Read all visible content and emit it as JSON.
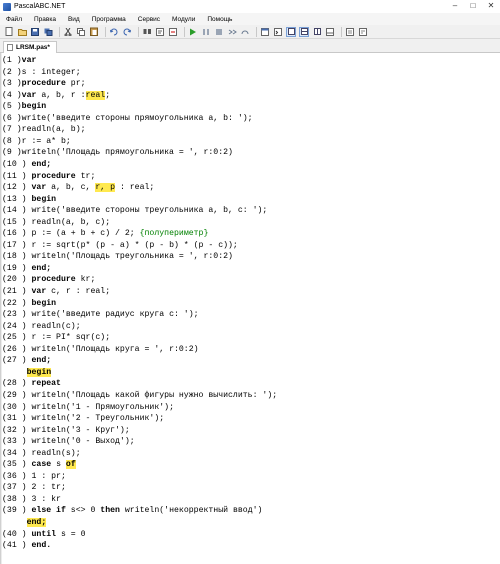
{
  "window": {
    "title": "PascalABC.NET",
    "minimize_glyph": "–",
    "maximize_glyph": "□",
    "close_glyph": "✕"
  },
  "menu": [
    "Файл",
    "Правка",
    "Вид",
    "Программа",
    "Сервис",
    "Модули",
    "Помощь"
  ],
  "toolbar": {
    "icons": [
      "new-file-icon",
      "open-icon",
      "save-icon",
      "save-all-icon",
      "cut-icon",
      "copy-icon",
      "paste-icon",
      "undo-icon",
      "redo-icon",
      "find-icon",
      "replace-icon",
      "goto-icon",
      "run-icon",
      "pause-icon",
      "stop-icon",
      "step-icon",
      "step-over-icon",
      "form-icon",
      "cmd-icon",
      "view1-icon",
      "view2-icon",
      "view3-icon",
      "output-icon",
      "help-icon",
      "about-icon"
    ]
  },
  "tab": {
    "label": "LRSM.pas*"
  },
  "code": {
    "highlight_color": "#ffe94f",
    "comment_color": "#008000",
    "lines": [
      {
        "n": "1",
        "segs": [
          {
            "t": "var",
            "k": "kw"
          }
        ]
      },
      {
        "n": "2",
        "segs": [
          {
            "t": "s : integer;"
          }
        ]
      },
      {
        "n": "3",
        "segs": [
          {
            "t": "procedure",
            "k": "kw"
          },
          {
            "t": " pr;"
          }
        ]
      },
      {
        "n": "4",
        "segs": [
          {
            "t": "var",
            "k": "kw"
          },
          {
            "t": " a, b, r :"
          },
          {
            "t": "real",
            "k": "hl"
          },
          {
            "t": ";"
          }
        ]
      },
      {
        "n": "5",
        "segs": [
          {
            "t": "begin",
            "k": "kw"
          }
        ]
      },
      {
        "n": "6",
        "segs": [
          {
            "t": "write('введите стороны прямоугольника a, b: ');"
          }
        ]
      },
      {
        "n": "7",
        "segs": [
          {
            "t": "readln(a, b);"
          }
        ]
      },
      {
        "n": "8",
        "segs": [
          {
            "t": "r := a* b;"
          }
        ]
      },
      {
        "n": "9",
        "segs": [
          {
            "t": "writeln('Площадь прямоугольника = ', r:0:2)"
          }
        ]
      },
      {
        "n": "10",
        "segs": [
          {
            "t": " end;",
            "k": "kw"
          }
        ]
      },
      {
        "n": "11",
        "segs": [
          {
            "t": " procedure",
            "k": "kw"
          },
          {
            "t": " tr;"
          }
        ]
      },
      {
        "n": "12",
        "segs": [
          {
            "t": " var",
            "k": "kw"
          },
          {
            "t": " a, b, c, "
          },
          {
            "t": "r, p",
            "k": "hl"
          },
          {
            "t": " : real;"
          }
        ]
      },
      {
        "n": "13",
        "segs": [
          {
            "t": " begin",
            "k": "kw"
          }
        ]
      },
      {
        "n": "14",
        "segs": [
          {
            "t": " write('введите стороны треугольника a, b, c: ');"
          }
        ]
      },
      {
        "n": "15",
        "segs": [
          {
            "t": " readln(a, b, c);"
          }
        ]
      },
      {
        "n": "16",
        "segs": [
          {
            "t": " p := (a + b + c) / 2; "
          },
          {
            "t": "{полупериметр}",
            "k": "cmt"
          }
        ]
      },
      {
        "n": "17",
        "segs": [
          {
            "t": " r := sqrt(p* (p - a) * (p - b) * (p - c));"
          }
        ]
      },
      {
        "n": "18",
        "segs": [
          {
            "t": " writeln('Площадь треугольника = ', r:0:2)"
          }
        ]
      },
      {
        "n": "19",
        "segs": [
          {
            "t": " end;",
            "k": "kw"
          }
        ]
      },
      {
        "n": "20",
        "segs": [
          {
            "t": " procedure",
            "k": "kw"
          },
          {
            "t": " kr;"
          }
        ]
      },
      {
        "n": "21",
        "segs": [
          {
            "t": " var",
            "k": "kw"
          },
          {
            "t": " c, r : real;"
          }
        ]
      },
      {
        "n": "22",
        "segs": [
          {
            "t": " begin",
            "k": "kw"
          }
        ]
      },
      {
        "n": "23",
        "segs": [
          {
            "t": " write('введите радиус круга c: ');"
          }
        ]
      },
      {
        "n": "24",
        "segs": [
          {
            "t": " readln(c);"
          }
        ]
      },
      {
        "n": "25",
        "segs": [
          {
            "t": " r := PI* sqr(c);"
          }
        ]
      },
      {
        "n": "26",
        "segs": [
          {
            "t": " writeln('Площадь круга = ', r:0:2)"
          }
        ]
      },
      {
        "n": "27",
        "segs": [
          {
            "t": " end;",
            "k": "kw"
          }
        ]
      },
      {
        "n": "",
        "segs": [
          {
            "t": "     "
          },
          {
            "t": "begin",
            "k": "kwhl"
          }
        ]
      },
      {
        "n": "28",
        "segs": [
          {
            "t": " repeat",
            "k": "kw"
          }
        ]
      },
      {
        "n": "29",
        "segs": [
          {
            "t": " writeln('Площадь какой фигуры нужно вычислить: ');"
          }
        ]
      },
      {
        "n": "30",
        "segs": [
          {
            "t": " writeln('1 - Прямоугольник');"
          }
        ]
      },
      {
        "n": "31",
        "segs": [
          {
            "t": " writeln('2 - Треугольник');"
          }
        ]
      },
      {
        "n": "32",
        "segs": [
          {
            "t": " writeln('3 - Круг');"
          }
        ]
      },
      {
        "n": "33",
        "segs": [
          {
            "t": " writeln('0 - Выход');"
          }
        ]
      },
      {
        "n": "34",
        "segs": [
          {
            "t": " readln(s);"
          }
        ]
      },
      {
        "n": "35",
        "segs": [
          {
            "t": " case",
            "k": "kw"
          },
          {
            "t": " s "
          },
          {
            "t": "of",
            "k": "kwhl"
          }
        ]
      },
      {
        "n": "36",
        "segs": [
          {
            "t": " 1 : pr;"
          }
        ]
      },
      {
        "n": "37",
        "segs": [
          {
            "t": " 2 : tr;"
          }
        ]
      },
      {
        "n": "38",
        "segs": [
          {
            "t": " 3 : kr"
          }
        ]
      },
      {
        "n": "39",
        "segs": [
          {
            "t": " else if",
            "k": "kw"
          },
          {
            "t": " s<> 0 "
          },
          {
            "t": "then",
            "k": "kw"
          },
          {
            "t": " writeln('некорректный ввод')"
          }
        ]
      },
      {
        "n": "",
        "segs": [
          {
            "t": "     "
          },
          {
            "t": "end;",
            "k": "kwhl"
          }
        ]
      },
      {
        "n": "40",
        "segs": [
          {
            "t": " until",
            "k": "kw"
          },
          {
            "t": " s = 0"
          }
        ]
      },
      {
        "n": "41",
        "segs": [
          {
            "t": " end.",
            "k": "kw"
          }
        ]
      }
    ]
  }
}
